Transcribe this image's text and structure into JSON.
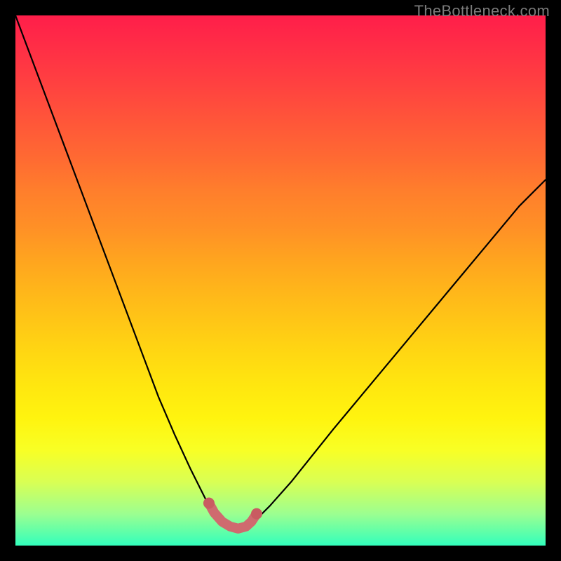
{
  "watermark": "TheBottleneck.com",
  "chart_data": {
    "type": "line",
    "title": "",
    "xlabel": "",
    "ylabel": "",
    "xlim": [
      0,
      100
    ],
    "ylim": [
      0,
      100
    ],
    "series": [
      {
        "name": "bottleneck-curve",
        "x": [
          0,
          3,
          6,
          9,
          12,
          15,
          18,
          21,
          24,
          27,
          30,
          33,
          36,
          37.5,
          39,
          40.5,
          42,
          43.5,
          45,
          48,
          52,
          56,
          60,
          65,
          70,
          75,
          80,
          85,
          90,
          95,
          100
        ],
        "y": [
          100,
          92,
          84,
          76,
          68,
          60,
          52,
          44,
          36,
          28,
          21,
          14.5,
          8.5,
          6.2,
          4.5,
          3.6,
          3.2,
          3.6,
          4.5,
          7.5,
          12,
          17,
          22,
          28,
          34,
          40,
          46,
          52,
          58,
          64,
          69
        ]
      },
      {
        "name": "optimal-range-marker",
        "x": [
          36.5,
          37.5,
          39,
          40.5,
          42,
          43.5,
          44.5,
          45.5
        ],
        "y": [
          8.0,
          6.2,
          4.5,
          3.6,
          3.2,
          3.6,
          4.5,
          6.0
        ]
      }
    ],
    "colors": {
      "curve": "#000000",
      "marker": "#cf6a6f",
      "marker_dot": "#c95b61"
    }
  }
}
